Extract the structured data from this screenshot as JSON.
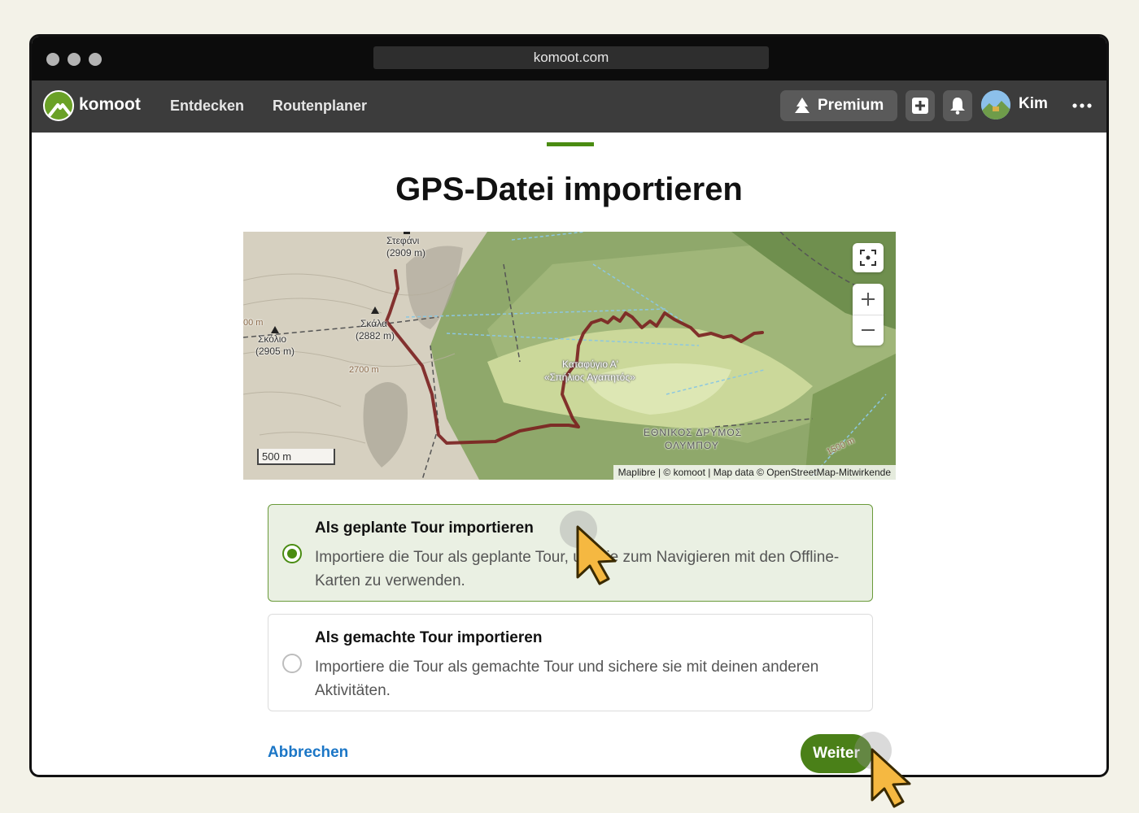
{
  "browser": {
    "url": "komoot.com"
  },
  "navbar": {
    "brand": "komoot",
    "links": [
      "Entdecken",
      "Routenplaner"
    ],
    "premium_label": "Premium",
    "user_name": "Kim",
    "icons": [
      "plus-icon",
      "bell-icon",
      "avatar",
      "more-icon"
    ]
  },
  "page": {
    "title": "GPS-Datei importieren"
  },
  "map": {
    "labels": {
      "peak1": "Στεφάνι",
      "peak1_elev": "(2909 m)",
      "peak2": "Σκόλιο",
      "peak2_elev": "(2905 m)",
      "peak3": "Σκάλα",
      "peak3_elev": "(2882 m)",
      "contour": "2700 m",
      "contour2": "1500 m",
      "contour3": "00 m",
      "hut_line1": "Καταφύγιο Α'",
      "hut_line2": "«Σπήλιος Αγαπητός»",
      "park_line1": "ΕΘΝΙΚΟΣ ΔΡΥΜΟΣ",
      "park_line2": "ΟΛΥΜΠΟΥ"
    },
    "scale": "500 m",
    "attribution": "Maplibre | © komoot | Map data © OpenStreetMap-Mitwirkende",
    "controls": [
      "fullscreen-icon",
      "zoom-in-icon",
      "zoom-out-icon"
    ],
    "route_color": "#7a1f1f"
  },
  "options": [
    {
      "title": "Als geplante Tour importieren",
      "description": "Importiere die Tour als geplante Tour, um sie zum Navigieren mit den Offline-Karten zu verwenden.",
      "selected": true
    },
    {
      "title": "Als gemachte Tour importieren",
      "description": "Importiere die Tour als gemachte Tour und sichere sie mit deinen anderen Aktivitäten.",
      "selected": false
    }
  ],
  "footer": {
    "cancel_label": "Abbrechen",
    "next_label": "Weiter"
  },
  "colors": {
    "accent": "#4a8c12",
    "link": "#1b76c6",
    "background": "#f3f2e8"
  }
}
